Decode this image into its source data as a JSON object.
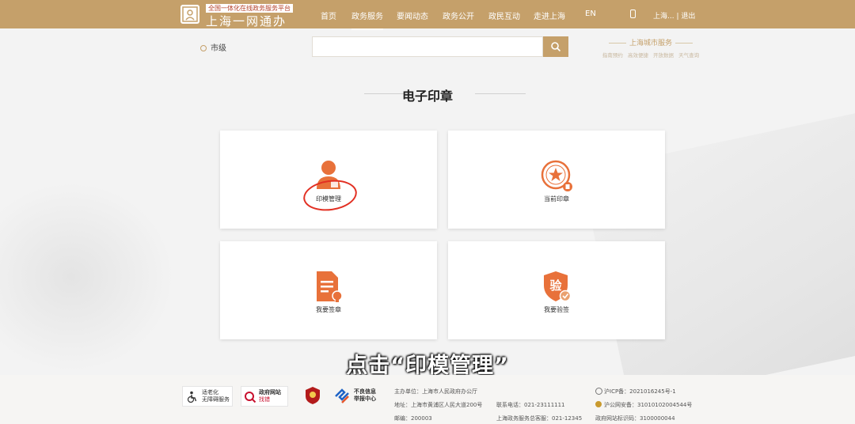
{
  "header": {
    "tagline": "全国一体化在线政务服务平台",
    "site_name": "上海一网通办",
    "nav": [
      {
        "label": "首页"
      },
      {
        "label": "政务服务"
      },
      {
        "label": "要闻动态"
      },
      {
        "label": "政务公开"
      },
      {
        "label": "政民互动"
      },
      {
        "label": "走进上海"
      },
      {
        "label": "EN"
      }
    ],
    "active_nav": "政务服务",
    "user": "上海...",
    "logout": "退出"
  },
  "search": {
    "region": "市级",
    "placeholder": "",
    "promo_title": "上海城市服务",
    "promo_links": [
      "指南预约",
      "高效便捷",
      "开放数据",
      "天气查询"
    ]
  },
  "page_title": "电子印章",
  "cards": [
    {
      "label": "印模管理",
      "icon": "person-icon"
    },
    {
      "label": "当前印章",
      "icon": "seal-icon"
    },
    {
      "label": "我要签章",
      "icon": "document-sign-icon"
    },
    {
      "label": "我要验签",
      "icon": "verify-shield-icon"
    }
  ],
  "subtitle": "点击“印模管理”",
  "footer": {
    "badge_accessibility": [
      "适老化",
      "无障碍服务"
    ],
    "badge_gov": [
      "政府网站",
      "找错"
    ],
    "badge_report": [
      "不良信息",
      "举报中心"
    ],
    "sponsor": "主办单位：上海市人民政府办公厅",
    "address": "地址：上海市黄浦区人民大道200号",
    "postcode": "邮编：200003",
    "phone": "联系电话：021-23111111",
    "hotline": "上海政务服务总客服：021-12345",
    "icp": "沪ICP备：2021016245号-1",
    "police": "沪公网安备：31010102004544号",
    "site_code": "政府网站标识码：3100000044"
  },
  "colors": {
    "brand_gold": "#c5a06a",
    "icon_orange": "#e8713a",
    "annotation_red": "#e23023"
  }
}
